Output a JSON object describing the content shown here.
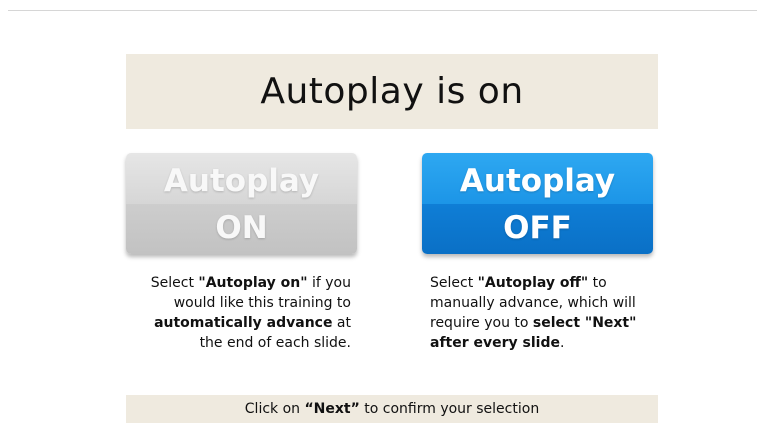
{
  "title": "Autoplay is on",
  "buttons": {
    "on": {
      "line1": "Autoplay",
      "line2": "ON"
    },
    "off": {
      "line1": "Autoplay",
      "line2": "OFF"
    }
  },
  "descriptions": {
    "on": {
      "t1": "Select ",
      "b1": "\"Autoplay on\"",
      "t2": " if you would like this training to ",
      "b2": "automatically advance",
      "t3": " at the end of each slide."
    },
    "off": {
      "t1": "Select ",
      "b1": "\"Autoplay off\"",
      "t2": " to manually advance, which will require you to ",
      "b2": "select \"Next\" after every slide",
      "t3": "."
    }
  },
  "footer": {
    "t1": "Click on ",
    "b1": "“Next”",
    "t2": " to confirm your selection"
  },
  "colors": {
    "banner": "#efeadf",
    "on_button": "#d6d6d6",
    "off_button": "#1c95e7"
  }
}
